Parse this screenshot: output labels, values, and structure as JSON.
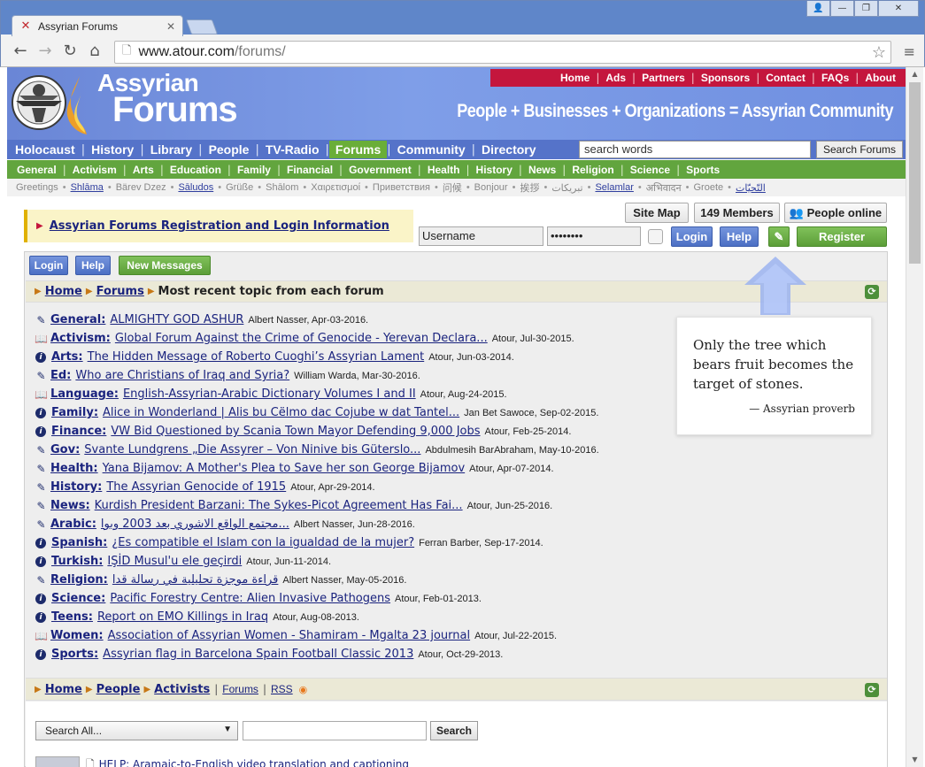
{
  "browser": {
    "tab_title": "Assyrian Forums",
    "tab_close": "✕",
    "favicon": "✕",
    "url_host": "www.atour.com",
    "url_path": "/forums/",
    "window_buttons": [
      "👤",
      "—",
      "❐",
      "✕"
    ],
    "nav_glyphs": {
      "back": "←",
      "forward": "→",
      "reload": "↻",
      "home": "⌂",
      "page": "🗋",
      "star": "☆",
      "menu": "≡"
    }
  },
  "banner": {
    "title_line1": "Assyrian",
    "title_line2": "Forums",
    "top_links": [
      "Home",
      "Ads",
      "Partners",
      "Sponsors",
      "Contact",
      "FAQs",
      "About"
    ],
    "slogan": "People + Businesses + Organizations = Assyrian Community",
    "colors": {
      "banner": "#6a86d6",
      "topbar": "#c4163d",
      "nav": "#5573c9",
      "cat": "#62a53e",
      "accent_active": "#6aae38"
    }
  },
  "main_nav": {
    "items": [
      "Holocaust",
      "History",
      "Library",
      "People",
      "TV-Radio",
      "Forums",
      "Community",
      "Directory"
    ],
    "active": "Forums",
    "search_placeholder": "search words",
    "search_button": "Search Forums"
  },
  "category_nav": [
    "General",
    "Activism",
    "Arts",
    "Education",
    "Family",
    "Financial",
    "Government",
    "Health",
    "History",
    "News",
    "Religion",
    "Science",
    "Sports"
  ],
  "greetings": [
    {
      "text": "Greetings",
      "link": false
    },
    {
      "text": "Shlāma",
      "link": true
    },
    {
      "text": "Bärev Dzez",
      "link": false
    },
    {
      "text": "Sāludos",
      "link": true
    },
    {
      "text": "Grüße",
      "link": false
    },
    {
      "text": "Shālom",
      "link": false
    },
    {
      "text": "Χαιρετισμοί",
      "link": false
    },
    {
      "text": "Приветствия",
      "link": false
    },
    {
      "text": "问候",
      "link": false
    },
    {
      "text": "Bonjour",
      "link": false
    },
    {
      "text": "挨拶",
      "link": false
    },
    {
      "text": "تبريكات",
      "link": false
    },
    {
      "text": "Selamlar",
      "link": true
    },
    {
      "text": "अभिवादन",
      "link": false
    },
    {
      "text": "Groete",
      "link": false
    },
    {
      "text": "التّحيّات",
      "link": true
    }
  ],
  "registration": {
    "notice": "Assyrian Forums Registration and Login Information",
    "site_map": "Site Map",
    "members": "149 Members",
    "people_online": "People online",
    "username_value": "Username",
    "password_value": "••••••••",
    "login": "Login",
    "help": "Help",
    "register": "Register"
  },
  "panel": {
    "login": "Login",
    "help": "Help",
    "new_messages": "New Messages",
    "breadcrumb": {
      "home": "Home",
      "forums": "Forums",
      "current": "Most recent topic from each forum"
    },
    "topics": [
      {
        "icon": "edit",
        "forum": "General:",
        "title": "ALMIGHTY GOD ASHUR",
        "meta": "Albert Nasser, Apr-03-2016."
      },
      {
        "icon": "book",
        "forum": "Activism:",
        "title": "Global Forum Against the Crime of Genocide - Yerevan Declara...",
        "meta": "Atour, Jul-30-2015."
      },
      {
        "icon": "info",
        "forum": "Arts:",
        "title": "The Hidden Message of Roberto Cuoghi’s Assyrian Lament",
        "meta": "Atour, Jun-03-2014."
      },
      {
        "icon": "edit",
        "forum": "Ed:",
        "title": "Who are Christians of Iraq and Syria?",
        "meta": "William Warda, Mar-30-2016."
      },
      {
        "icon": "book",
        "forum": "Language:",
        "title": "English-Assyrian-Arabic Dictionary Volumes I and II",
        "meta": "Atour, Aug-24-2015."
      },
      {
        "icon": "info",
        "forum": "Family:",
        "title": "Alice in Wonderland | Alis bu Cëlmo dac Cojube w dat Tantel...",
        "meta": "Jan Bet Sawoce, Sep-02-2015."
      },
      {
        "icon": "info",
        "forum": "Finance:",
        "title": "VW Bid Questioned by Scania Town Mayor Defending 9,000 Jobs",
        "meta": "Atour, Feb-25-2014."
      },
      {
        "icon": "edit",
        "forum": "Gov:",
        "title": "Svante Lundgrens „Die Assyrer – Von Ninive bis Gütersl​o...",
        "meta": "Abdulmesih BarAbraham, May-10-2016."
      },
      {
        "icon": "edit",
        "forum": "Health:",
        "title": "Yana Bijamov: A Mother's Plea to Save her son George Bijamov",
        "meta": "Atour, Apr-07-2014."
      },
      {
        "icon": "edit",
        "forum": "History:",
        "title": "The Assyrian Genocide of 1915",
        "meta": "Atour, Apr-29-2014."
      },
      {
        "icon": "edit",
        "forum": "News:",
        "title": "Kurdish President Barzani: The Sykes-Picot Agreement Has Fai...",
        "meta": "Atour, Jun-25-2016."
      },
      {
        "icon": "edit",
        "forum": "Arabic:",
        "title": "مجتمع الواقع الاشوري بعد 2003 وبوا...",
        "meta": "Albert Nasser, Jun-28-2016."
      },
      {
        "icon": "info",
        "forum": "Spanish:",
        "title": "¿Es compatible el Islam con la igualdad de la mujer?",
        "meta": "Ferran Barber, Sep-17-2014."
      },
      {
        "icon": "info",
        "forum": "Turkish:",
        "title": "IŞİD Musul'u ele geçirdi",
        "meta": "Atour, Jun-11-2014."
      },
      {
        "icon": "edit",
        "forum": "Religion:",
        "title": "قراءة موجزة تحليلية في رسالة قدا",
        "meta": "Albert Nasser, May-05-2016."
      },
      {
        "icon": "info",
        "forum": "Science:",
        "title": "Pacific Forestry Centre: Alien Invasive Pathogens",
        "meta": "Atour, Feb-01-2013."
      },
      {
        "icon": "info",
        "forum": "Teens:",
        "title": "Report on EMO Killings in Iraq",
        "meta": "Atour, Aug-08-2013."
      },
      {
        "icon": "book",
        "forum": "Women:",
        "title": "Association of Assyrian Women - Shamiram - Mgalta 23 journal",
        "meta": "Atour, Jul-22-2015."
      },
      {
        "icon": "info",
        "forum": "Sports:",
        "title": "Assyrian flag in Barcelona Spain Football Classic 2013",
        "meta": "Atour, Oct-29-2013."
      }
    ],
    "quote": {
      "text": "Only the tree which bears fruit becomes the target of stones.",
      "source": "— Assyrian proverb"
    },
    "breadcrumb2": {
      "home": "Home",
      "people": "People",
      "activists": "Activists",
      "forums": "Forums",
      "rss": "RSS"
    },
    "search_select": "Search All...",
    "search_button": "Search",
    "help_link": "HELP: Aramaic-to-English video translation and captioning"
  }
}
